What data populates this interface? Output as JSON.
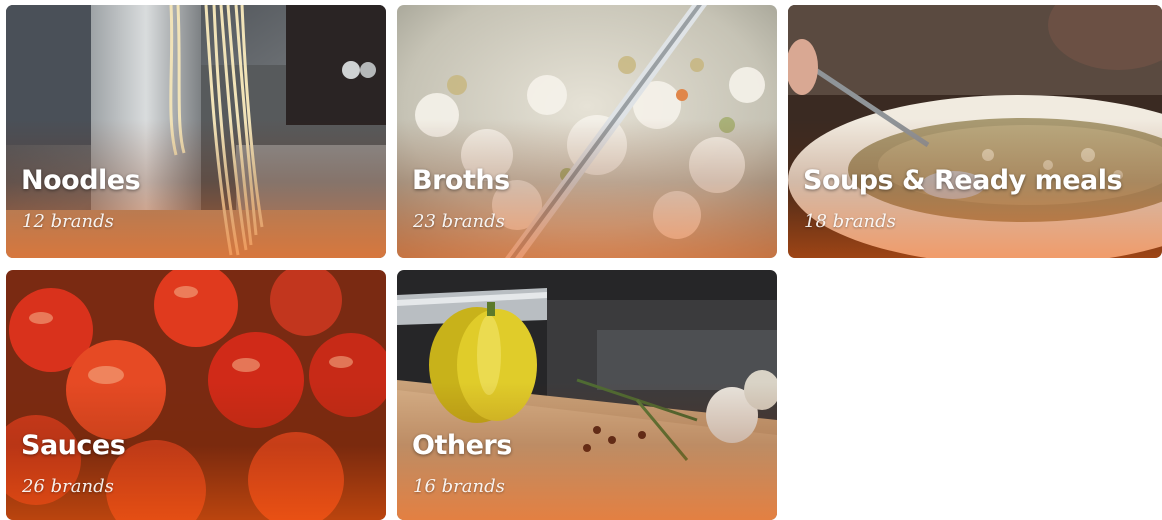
{
  "categories": [
    {
      "title": "Noodles",
      "count": "12 brands",
      "photo": "noodles-photo"
    },
    {
      "title": "Broths",
      "count": "23 brands",
      "photo": "broth-photo"
    },
    {
      "title": "Soups & Ready meals",
      "count": "18 brands",
      "photo": "soup-photo"
    },
    {
      "title": "Sauces",
      "count": "26 brands",
      "photo": "tomatoes-photo"
    },
    {
      "title": "Others",
      "count": "16 brands",
      "photo": "pepper-photo"
    }
  ],
  "colors": {
    "overlay_accent": "#f05a0a",
    "title_text": "#ffffff"
  }
}
